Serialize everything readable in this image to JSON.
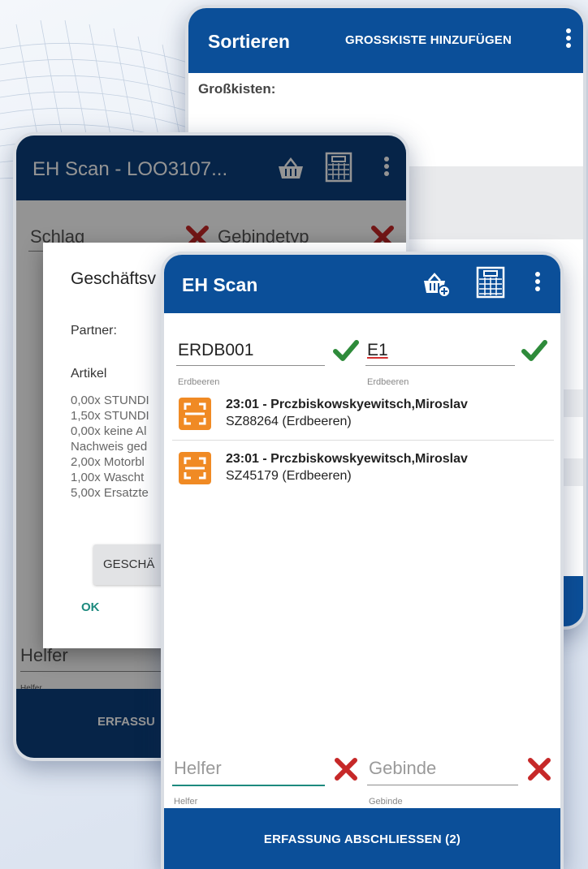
{
  "colors": {
    "appbar_blue": "#0b4f99",
    "appbar_dark_blue": "#0b3f7c",
    "success_green": "#2e8b3a",
    "error_red": "#c62828",
    "scan_orange": "#f08a24",
    "ok_teal": "#1d8a7e"
  },
  "sort_screen": {
    "title": "Sortieren",
    "action": "GROSSKISTE HINZUFÜGEN",
    "section_label": "Großkisten:"
  },
  "scan_session_screen": {
    "title": "EH Scan - LOO3107...",
    "fields": {
      "schlag": "Schlag",
      "gebindetyp": "Gebindetyp",
      "helfer": "Helfer",
      "helfer_helper": "Helfer"
    },
    "footer_label": "ERFASSU"
  },
  "dialog": {
    "title": "Geschäftsv",
    "partner_label": "Partner:",
    "artikel_label": "Artikel",
    "items": [
      "0,00x STUNDI",
      "1,50x STUNDI",
      "0,00x keine Al",
      "Nachweis ged",
      "2,00x Motorbl",
      "1,00x Wascht",
      "5,00x Ersatzte"
    ],
    "button_label": "GESCHÄ",
    "ok_label": "OK"
  },
  "scan_screen": {
    "title": "EH Scan",
    "field_left": {
      "value": "ERDB001",
      "helper": "Erdbeeren"
    },
    "field_right": {
      "value": "E1",
      "helper": "Erdbeeren"
    },
    "entries": [
      {
        "line1": "23:01 - Prczbiskowskyewitsch,Miroslav",
        "line2": "SZ88264 (Erdbeeren)"
      },
      {
        "line1": "23:01 - Prczbiskowskyewitsch,Miroslav",
        "line2": "SZ45179 (Erdbeeren)"
      }
    ],
    "helfer": {
      "placeholder": "Helfer",
      "helper": "Helfer"
    },
    "gebinde": {
      "placeholder": "Gebinde",
      "helper": "Gebinde"
    },
    "footer_button": "ERFASSUNG ABSCHLIESSEN (2)"
  }
}
